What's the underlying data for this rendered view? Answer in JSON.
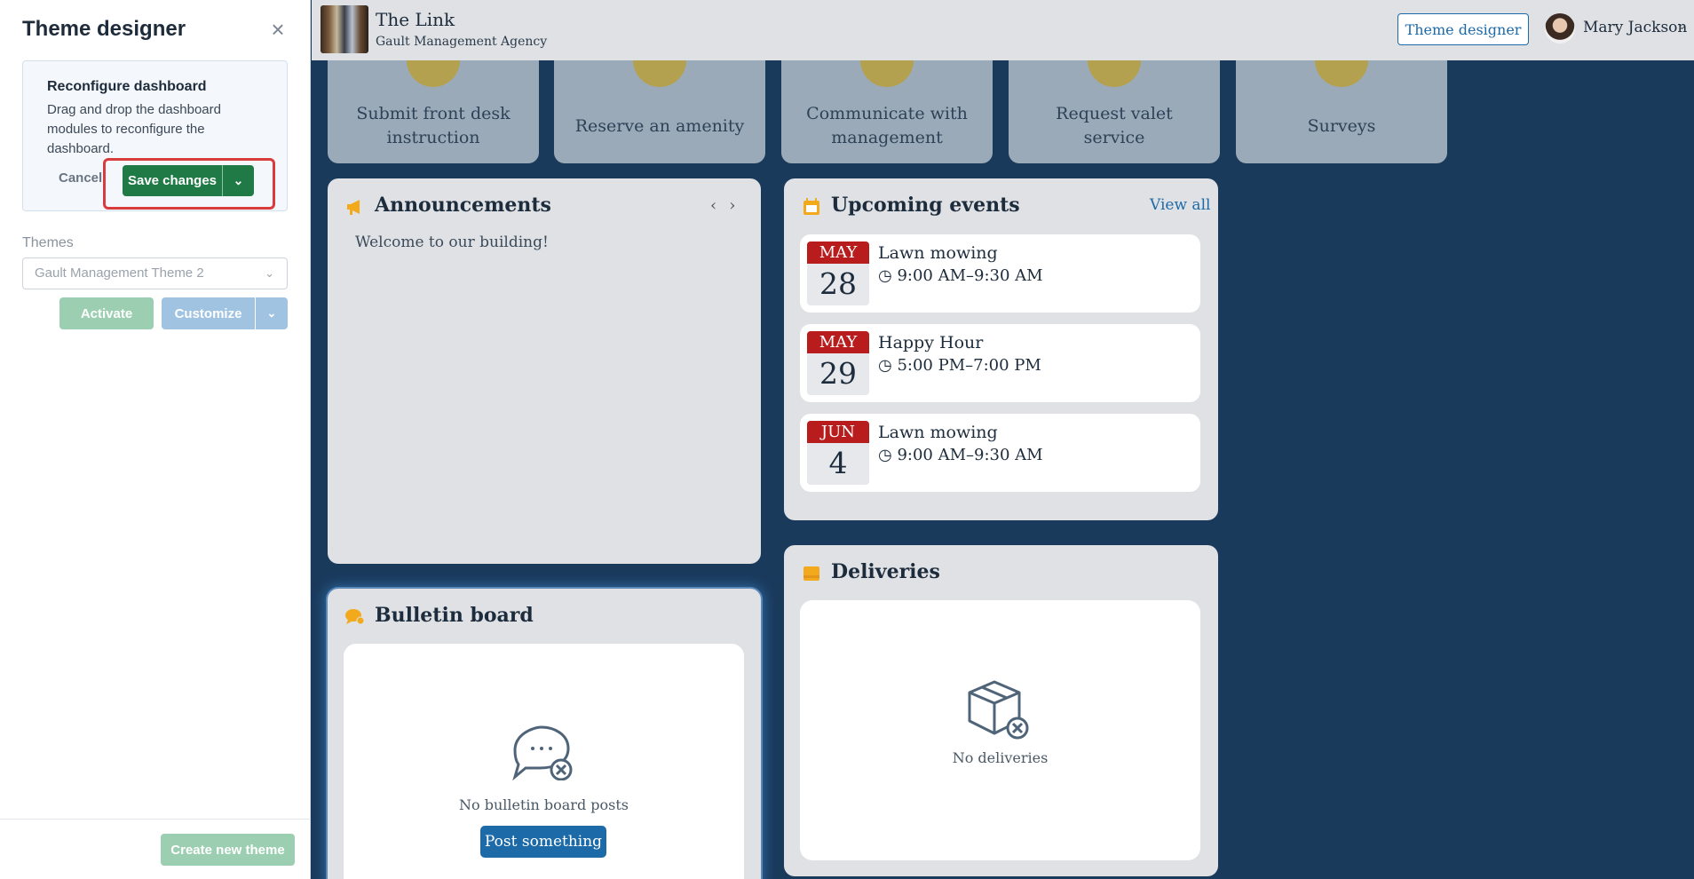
{
  "panel": {
    "title": "Theme designer",
    "reconfigure": {
      "title": "Reconfigure dashboard",
      "text": "Drag and drop the dashboard modules to reconfigure the dashboard.",
      "cancel_label": "Cancel",
      "save_label": "Save changes"
    },
    "themes_label": "Themes",
    "theme_select_value": "Gault Management Theme 2",
    "activate_label": "Activate",
    "customize_label": "Customize",
    "create_label": "Create new theme"
  },
  "header": {
    "site_name": "The Link",
    "site_sub": "Gault Management Agency",
    "theme_designer_label": "Theme designer",
    "user_name": "Mary Jackson"
  },
  "quick_actions": [
    {
      "label": "Submit front desk instruction"
    },
    {
      "label": "Reserve an amenity"
    },
    {
      "label": "Communicate with management"
    },
    {
      "label": "Request valet service"
    },
    {
      "label": "Surveys"
    }
  ],
  "announcements": {
    "title": "Announcements",
    "text": "Welcome to our building!"
  },
  "events": {
    "title": "Upcoming events",
    "view_all": "View all",
    "items": [
      {
        "month": "MAY",
        "day": "28",
        "title": "Lawn mowing",
        "time": "9:00 AM–9:30 AM"
      },
      {
        "month": "MAY",
        "day": "29",
        "title": "Happy Hour",
        "time": "5:00 PM–7:00 PM"
      },
      {
        "month": "JUN",
        "day": "4",
        "title": "Lawn mowing",
        "time": "9:00 AM–9:30 AM"
      }
    ]
  },
  "bulletin": {
    "title": "Bulletin board",
    "empty_text": "No bulletin board posts",
    "post_label": "Post something"
  },
  "deliveries": {
    "title": "Deliveries",
    "empty_text": "No deliveries"
  },
  "colors": {
    "accent_green": "#1f7a45",
    "accent_blue": "#1d6aa8",
    "background": "#1a3a5c",
    "calendar_red": "#b81c1c",
    "icon_gold": "#f2a91c"
  }
}
